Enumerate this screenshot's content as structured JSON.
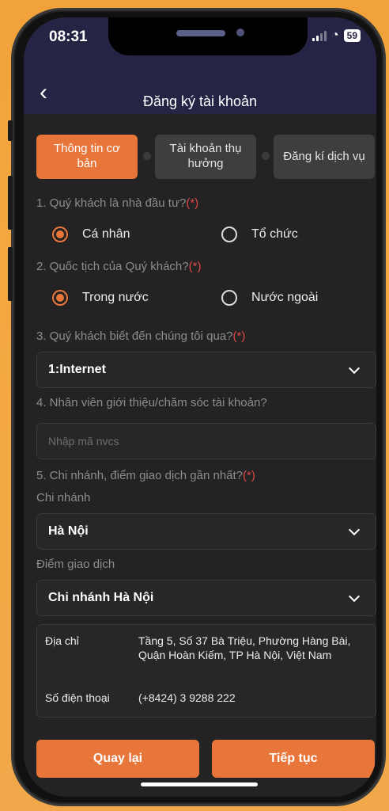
{
  "status_bar": {
    "time": "08:31",
    "battery": "59"
  },
  "header": {
    "title": "Đăng ký tài khoản"
  },
  "steps": [
    {
      "label": "Thông tin cơ bản"
    },
    {
      "label": "Tài khoản thụ hưởng"
    },
    {
      "label": "Đăng kí dịch vụ"
    }
  ],
  "form": {
    "q1": {
      "label": "1. Quý khách là nhà đầu tư?",
      "required": "(*)",
      "options": [
        "Cá nhân",
        "Tổ chức"
      ],
      "selected": "Cá nhân"
    },
    "q2": {
      "label": "2. Quốc tịch của Quý khách?",
      "required": "(*)",
      "options": [
        "Trong nước",
        "Nước ngoài"
      ],
      "selected": "Trong nước"
    },
    "q3": {
      "label": "3. Quý khách biết đến chúng tôi qua?",
      "required": "(*)",
      "value": "1:Internet"
    },
    "q4": {
      "label": "4. Nhân viên giới thiệu/chăm sóc tài khoản?",
      "placeholder": "Nhập mã nvcs"
    },
    "q5": {
      "label": "5. Chi nhánh, điểm giao dịch gần nhất?",
      "required": "(*)",
      "branch_label": "Chi nhánh",
      "branch_value": "Hà Nội",
      "office_label": "Điểm giao dịch",
      "office_value": "Chi nhánh Hà Nội"
    }
  },
  "info": {
    "address_label": "Địa chỉ",
    "address_value": "Tầng 5, Số 37 Bà Triệu, Phường Hàng Bài, Quận Hoàn Kiếm, TP Hà Nội, Việt Nam",
    "phone_label": "Số điện thoại",
    "phone_value": "(+8424) 3 9288 222"
  },
  "buttons": {
    "back": "Quay lại",
    "next": "Tiếp tục"
  },
  "colors": {
    "accent": "#e8763a",
    "header": "#262444",
    "background": "#232323"
  }
}
